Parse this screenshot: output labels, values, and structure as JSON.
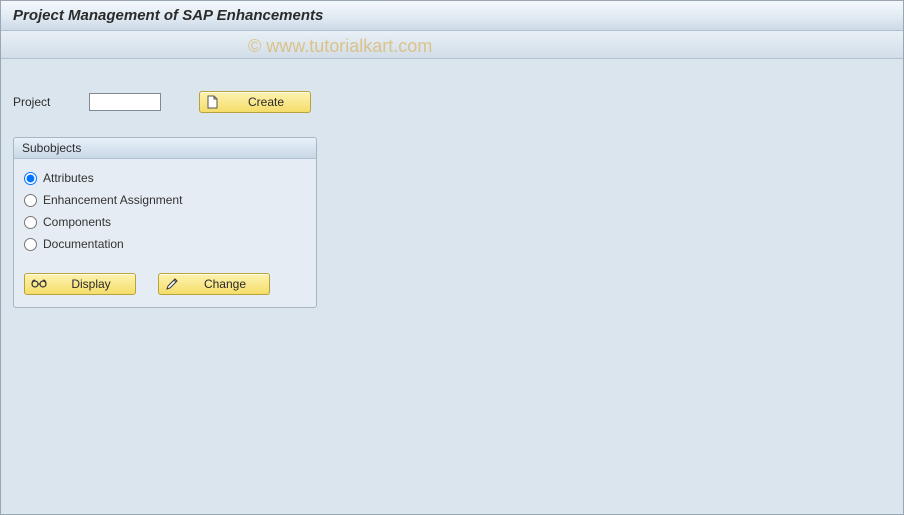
{
  "title": "Project Management of SAP Enhancements",
  "watermark": "© www.tutorialkart.com",
  "project": {
    "label": "Project",
    "value": "",
    "create_label": "Create"
  },
  "subobjects": {
    "header": "Subobjects",
    "options": [
      {
        "label": "Attributes",
        "selected": true
      },
      {
        "label": "Enhancement Assignment",
        "selected": false
      },
      {
        "label": "Components",
        "selected": false
      },
      {
        "label": "Documentation",
        "selected": false
      }
    ],
    "display_label": "Display",
    "change_label": "Change"
  }
}
